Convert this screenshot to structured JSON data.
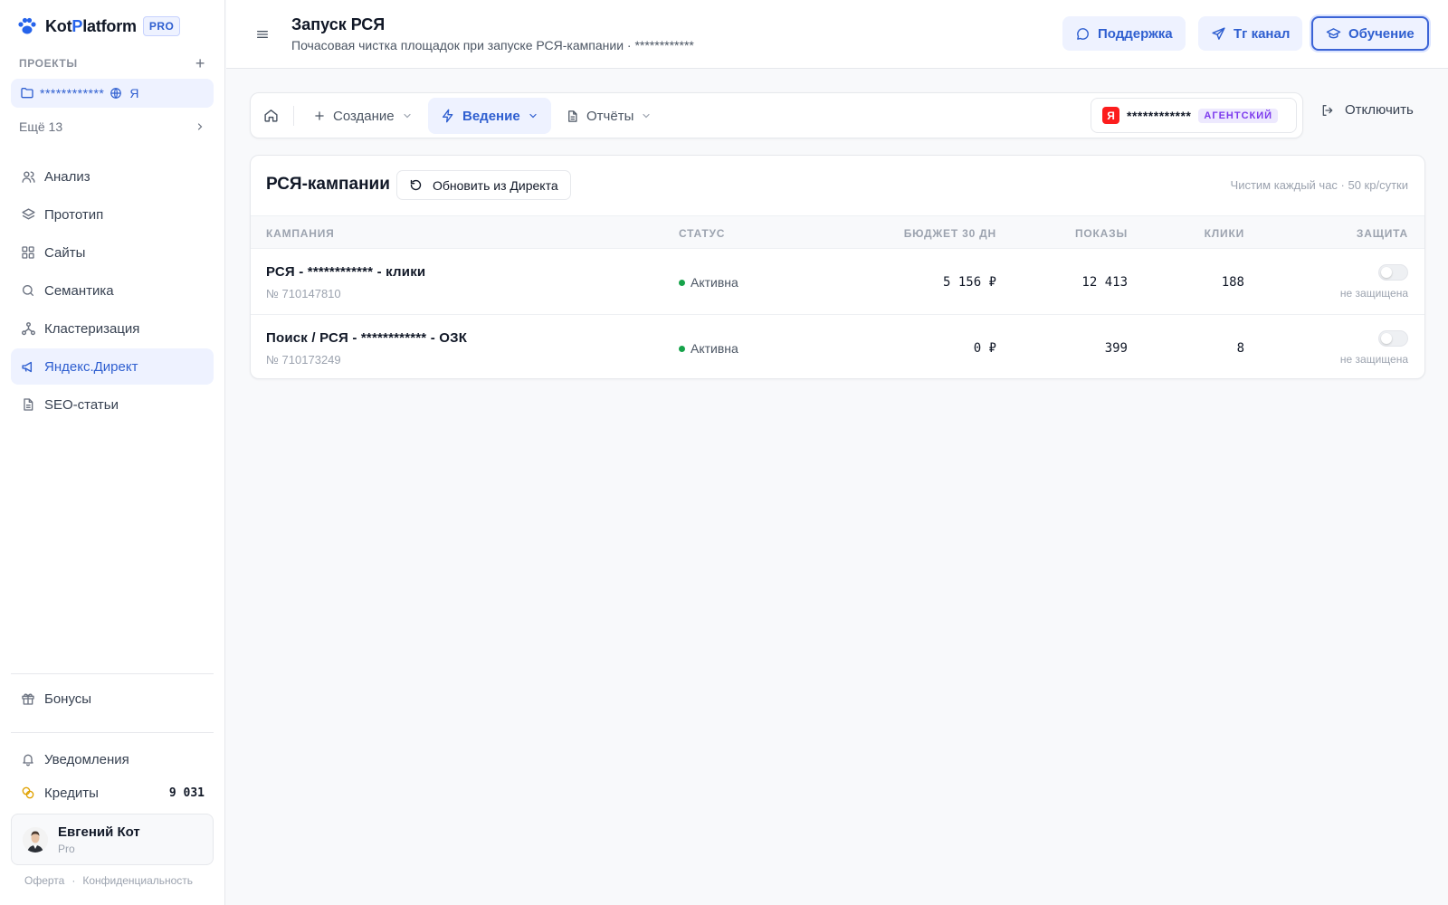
{
  "brand": {
    "name_part1": "Kot",
    "name_accent": "P",
    "name_part2": "latform",
    "badge": "PRO"
  },
  "sidebar": {
    "projects_title": "ПРОЕКТЫ",
    "add_symbol": "+",
    "current_project": {
      "name": "************",
      "suffix": "Я"
    },
    "more_label": "Ещё 13",
    "nav": [
      {
        "label": "Анализ",
        "icon": "users-icon"
      },
      {
        "label": "Прототип",
        "icon": "layers-icon"
      },
      {
        "label": "Сайты",
        "icon": "grid-icon"
      },
      {
        "label": "Семантика",
        "icon": "search-icon"
      },
      {
        "label": "Кластеризация",
        "icon": "cluster-icon"
      },
      {
        "label": "Яндекс.Директ",
        "icon": "megaphone-icon",
        "active": true
      },
      {
        "label": "SEO-статьи",
        "icon": "document-icon"
      }
    ],
    "bonuses": "Бонусы",
    "notifications": "Уведомления",
    "credits_label": "Кредиты",
    "credits_value": "9 031",
    "user": {
      "name": "Евгений Кот",
      "plan": "Pro"
    },
    "legal": {
      "offer": "Оферта",
      "sep": "·",
      "privacy": "Конфиденциальность"
    }
  },
  "header": {
    "title": "Запуск РСЯ",
    "subtitle": "Почасовая чистка площадок при запуске РСЯ-кампании · ************",
    "buttons": {
      "support": "Поддержка",
      "tg": "Тг канал",
      "learning": "Обучение"
    }
  },
  "toolbar": {
    "menus": {
      "create": "Создание",
      "manage": "Ведение",
      "reports": "Отчёты"
    },
    "account": {
      "badge": "Я",
      "name": "************",
      "tag": "АГЕНТСКИЙ"
    },
    "disconnect": "Отключить"
  },
  "campaigns": {
    "title": "РСЯ-кампании",
    "refresh": "Обновить из Директа",
    "note": "Чистим каждый час · 50 кр/сутки",
    "columns": {
      "campaign": "КАМПАНИЯ",
      "status": "СТАТУС",
      "budget": "БЮДЖЕТ 30 ДН",
      "impressions": "ПОКАЗЫ",
      "clicks": "КЛИКИ",
      "protection": "ЗАЩИТА"
    },
    "rows": [
      {
        "name": "РСЯ - ************ - клики",
        "id": "№ 710147810",
        "status": "Активна",
        "budget": "5 156 ₽",
        "impressions": "12 413",
        "clicks": "188",
        "protection": "не защищена"
      },
      {
        "name": "Поиск / РСЯ - ************ - ОЗК",
        "id": "№ 710173249",
        "status": "Активна",
        "budget": "0 ₽",
        "impressions": "399",
        "clicks": "8",
        "protection": "не защищена"
      }
    ]
  },
  "colors": {
    "accent": "#2f5fd0",
    "accent_bg": "#eef2ff",
    "status_active": "#16a34a",
    "yandex_red": "#fc1d1d",
    "tag_purple": "#7c3aed"
  }
}
